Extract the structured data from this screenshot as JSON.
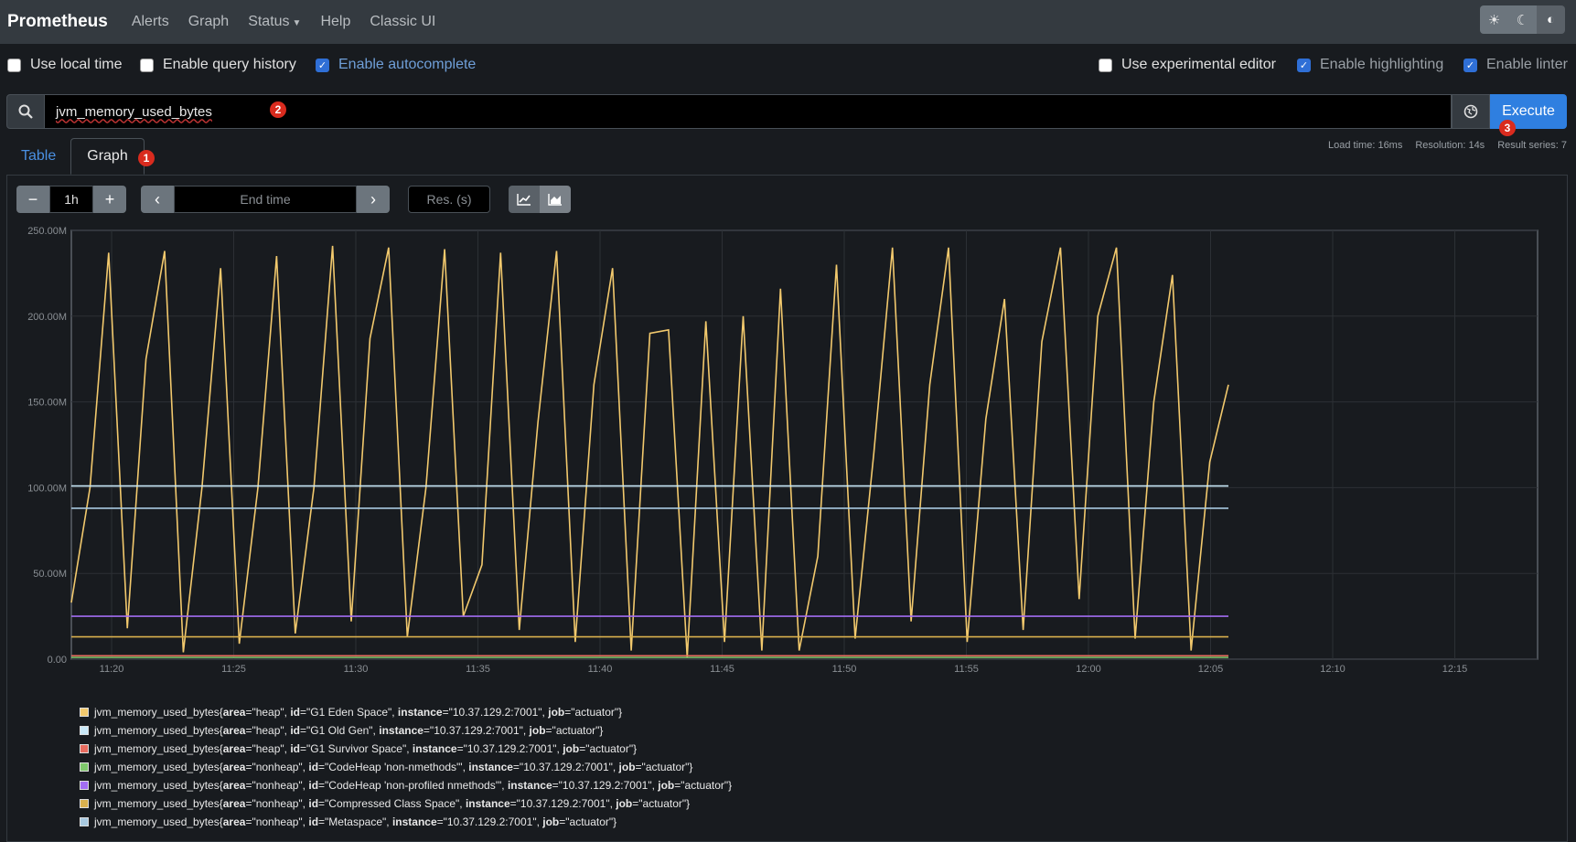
{
  "nav": {
    "brand": "Prometheus",
    "links": [
      "Alerts",
      "Graph",
      "Status",
      "Help",
      "Classic UI"
    ]
  },
  "options": {
    "use_local_time": "Use local time",
    "enable_query_history": "Enable query history",
    "enable_autocomplete": "Enable autocomplete",
    "use_experimental_editor": "Use experimental editor",
    "enable_highlighting": "Enable highlighting",
    "enable_linter": "Enable linter"
  },
  "query": {
    "expression": "jvm_memory_used_bytes",
    "execute_label": "Execute"
  },
  "tabs": [
    "Table",
    "Graph"
  ],
  "stats": {
    "load_time": "Load time: 16ms",
    "resolution": "Resolution: 14s",
    "result_series": "Result series: 7"
  },
  "controls": {
    "range": "1h",
    "end_time_placeholder": "End time",
    "res_placeholder": "Res. (s)"
  },
  "badges": [
    "1",
    "2",
    "3"
  ],
  "chart_data": {
    "type": "line",
    "ylim": [
      0,
      250000000
    ],
    "y_ticks": [
      "0.00",
      "50.00M",
      "100.00M",
      "150.00M",
      "200.00M",
      "250.00M"
    ],
    "x_ticks": [
      "11:20",
      "11:25",
      "11:30",
      "11:35",
      "11:40",
      "11:45",
      "11:50",
      "11:55",
      "12:00",
      "12:05",
      "12:10",
      "12:15"
    ],
    "grid": true,
    "series": [
      {
        "color": "#f2c96d",
        "legend": {
          "area": "heap",
          "id": "G1 Eden Space",
          "instance": "10.37.129.2:7001",
          "job": "actuator"
        },
        "values_m": [
          33,
          100,
          237,
          18,
          175,
          238,
          4,
          100,
          228,
          9,
          100,
          235,
          15,
          100,
          241,
          22,
          187,
          240,
          13,
          100,
          239,
          25,
          55,
          237,
          17,
          138,
          238,
          10,
          160,
          228,
          5,
          190,
          192,
          1,
          197,
          10,
          200,
          5,
          216,
          5,
          60,
          230,
          12,
          120,
          240,
          22,
          160,
          240,
          10,
          140,
          210,
          17,
          185,
          240,
          35,
          200,
          240,
          12,
          150,
          224,
          5,
          115,
          160
        ]
      },
      {
        "color": "#c9e8f8",
        "legend": {
          "area": "heap",
          "id": "G1 Old Gen",
          "instance": "10.37.129.2:7001",
          "job": "actuator"
        },
        "level_m": 101
      },
      {
        "color": "#e86c5f",
        "legend": {
          "area": "heap",
          "id": "G1 Survivor Space",
          "instance": "10.37.129.2:7001",
          "job": "actuator"
        },
        "level_m": 2
      },
      {
        "color": "#7ec76b",
        "legend": {
          "area": "nonheap",
          "id": "CodeHeap 'non-nmethods'",
          "instance": "10.37.129.2:7001",
          "job": "actuator"
        },
        "level_m": 1
      },
      {
        "color": "#a26df2",
        "legend": {
          "area": "nonheap",
          "id": "CodeHeap 'non-profiled nmethods'",
          "instance": "10.37.129.2:7001",
          "job": "actuator"
        },
        "level_m": 25
      },
      {
        "color": "#d9b04e",
        "legend": {
          "area": "nonheap",
          "id": "Compressed Class Space",
          "instance": "10.37.129.2:7001",
          "job": "actuator"
        },
        "level_m": 13
      },
      {
        "color": "#a8c9e0",
        "legend": {
          "area": "nonheap",
          "id": "Metaspace",
          "instance": "10.37.129.2:7001",
          "job": "actuator"
        },
        "level_m": 88
      }
    ]
  }
}
